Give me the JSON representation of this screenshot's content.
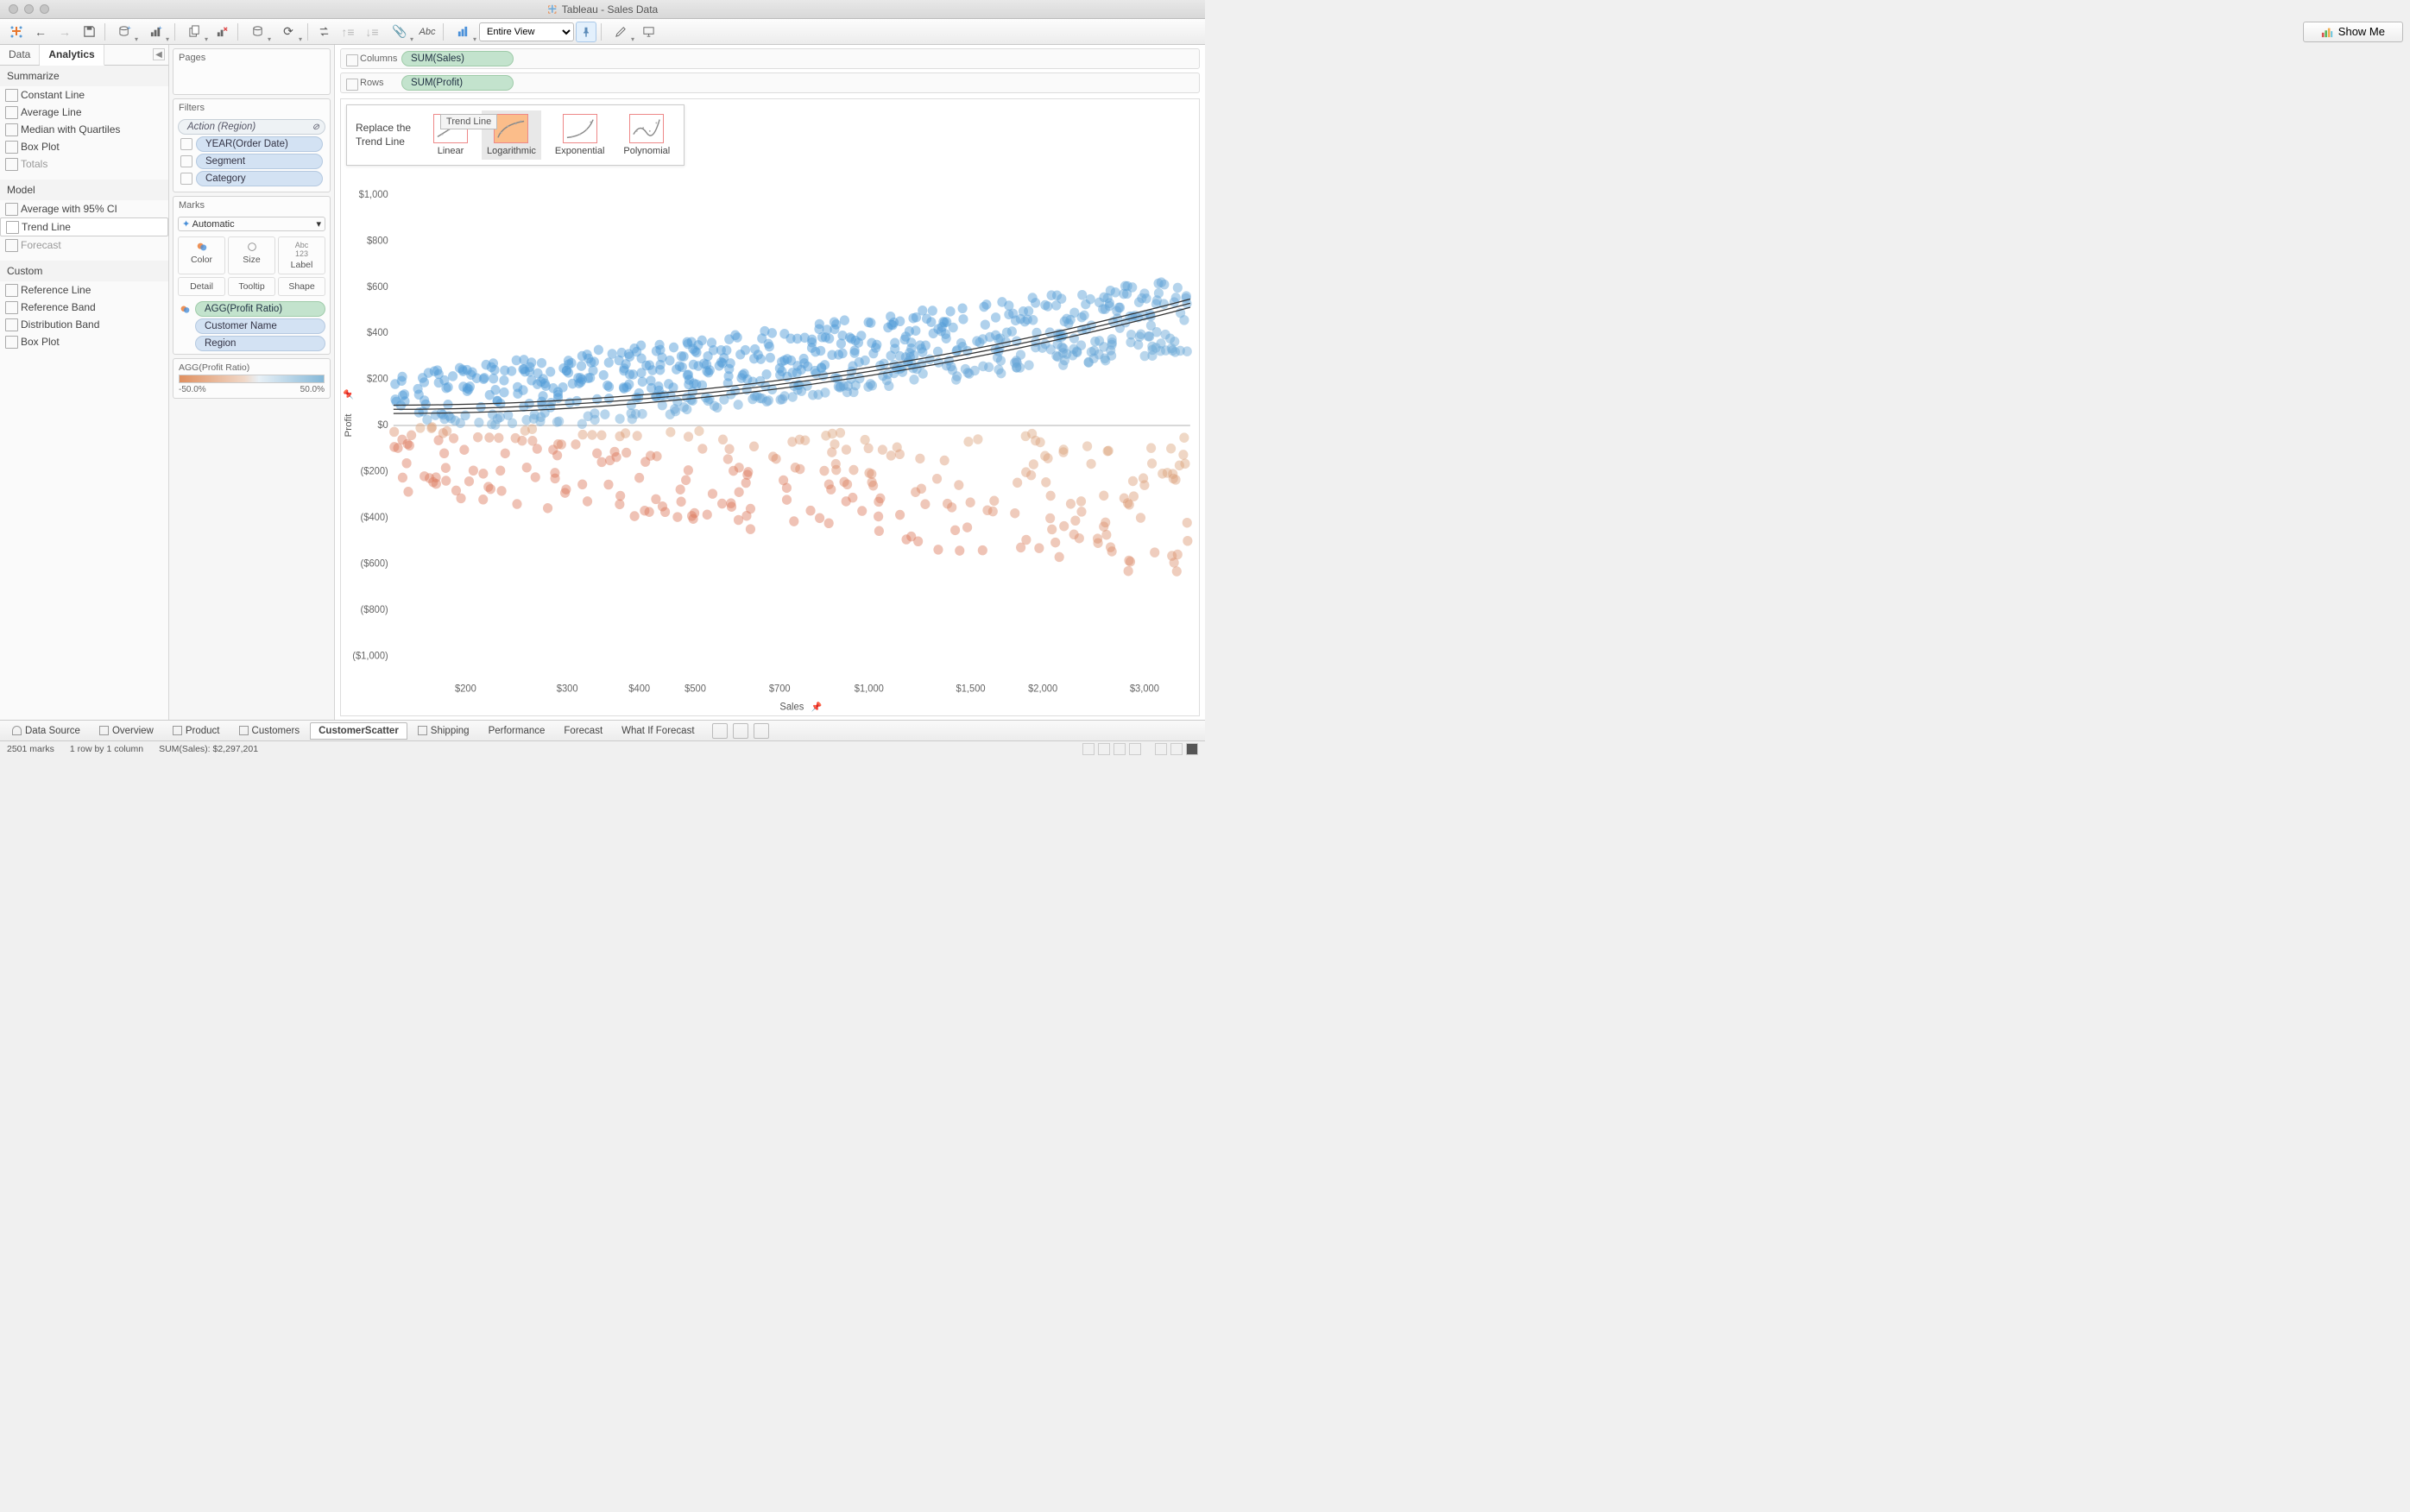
{
  "title": "Tableau - Sales Data",
  "toolbar": {
    "fit": "Entire View",
    "showme": "Show Me"
  },
  "side_tabs": {
    "data": "Data",
    "analytics": "Analytics"
  },
  "analytics": {
    "summarize_head": "Summarize",
    "summarize": [
      "Constant Line",
      "Average Line",
      "Median with Quartiles",
      "Box Plot",
      "Totals"
    ],
    "model_head": "Model",
    "model": [
      "Average with 95% CI",
      "Trend Line",
      "Forecast"
    ],
    "custom_head": "Custom",
    "custom": [
      "Reference Line",
      "Reference Band",
      "Distribution Band",
      "Box Plot"
    ]
  },
  "cards": {
    "pages": "Pages",
    "filters": "Filters",
    "filter_items": [
      "Action (Region)",
      "YEAR(Order Date)",
      "Segment",
      "Category"
    ],
    "marks": "Marks",
    "marks_type": "Automatic",
    "marks_cells": [
      "Color",
      "Size",
      "Label",
      "Detail",
      "Tooltip",
      "Shape"
    ],
    "marks_pills": [
      "AGG(Profit Ratio)",
      "Customer Name",
      "Region"
    ],
    "legend_title": "AGG(Profit Ratio)",
    "legend_min": "-50.0%",
    "legend_max": "50.0%"
  },
  "shelves": {
    "columns": "Columns",
    "columns_pill": "SUM(Sales)",
    "rows": "Rows",
    "rows_pill": "SUM(Profit)"
  },
  "trend": {
    "replace1": "Replace the",
    "replace2": "Trend Line",
    "ghost": "Trend Line",
    "linear": "Linear",
    "log": "Logarithmic",
    "exp": "Exponential",
    "poly": "Polynomial"
  },
  "sheets": [
    "Data Source",
    "Overview",
    "Product",
    "Customers",
    "CustomerScatter",
    "Shipping",
    "Performance",
    "Forecast",
    "What If Forecast"
  ],
  "status": {
    "marks": "2501 marks",
    "rc": "1 row by 1 column",
    "sum": "SUM(Sales): $2,297,201"
  },
  "chart_data": {
    "type": "scatter",
    "xlabel": "Sales",
    "ylabel": "Profit",
    "x_ticks": [
      "$200",
      "$300",
      "$400",
      "$500",
      "$700",
      "$1,000",
      "$1,500",
      "$2,000",
      "$3,000"
    ],
    "y_ticks": [
      "($1,000)",
      "($800)",
      "($600)",
      "($400)",
      "($200)",
      "$0",
      "$200",
      "$400",
      "$600",
      "$800",
      "$1,000"
    ],
    "xlim": [
      150,
      3600
    ],
    "ylim": [
      -1100,
      1100
    ],
    "x_scale": "log",
    "color_by": "AGG(Profit Ratio)",
    "color_range": [
      -0.5,
      0.5
    ],
    "trend_type": "logarithmic",
    "n_points": 2501
  }
}
